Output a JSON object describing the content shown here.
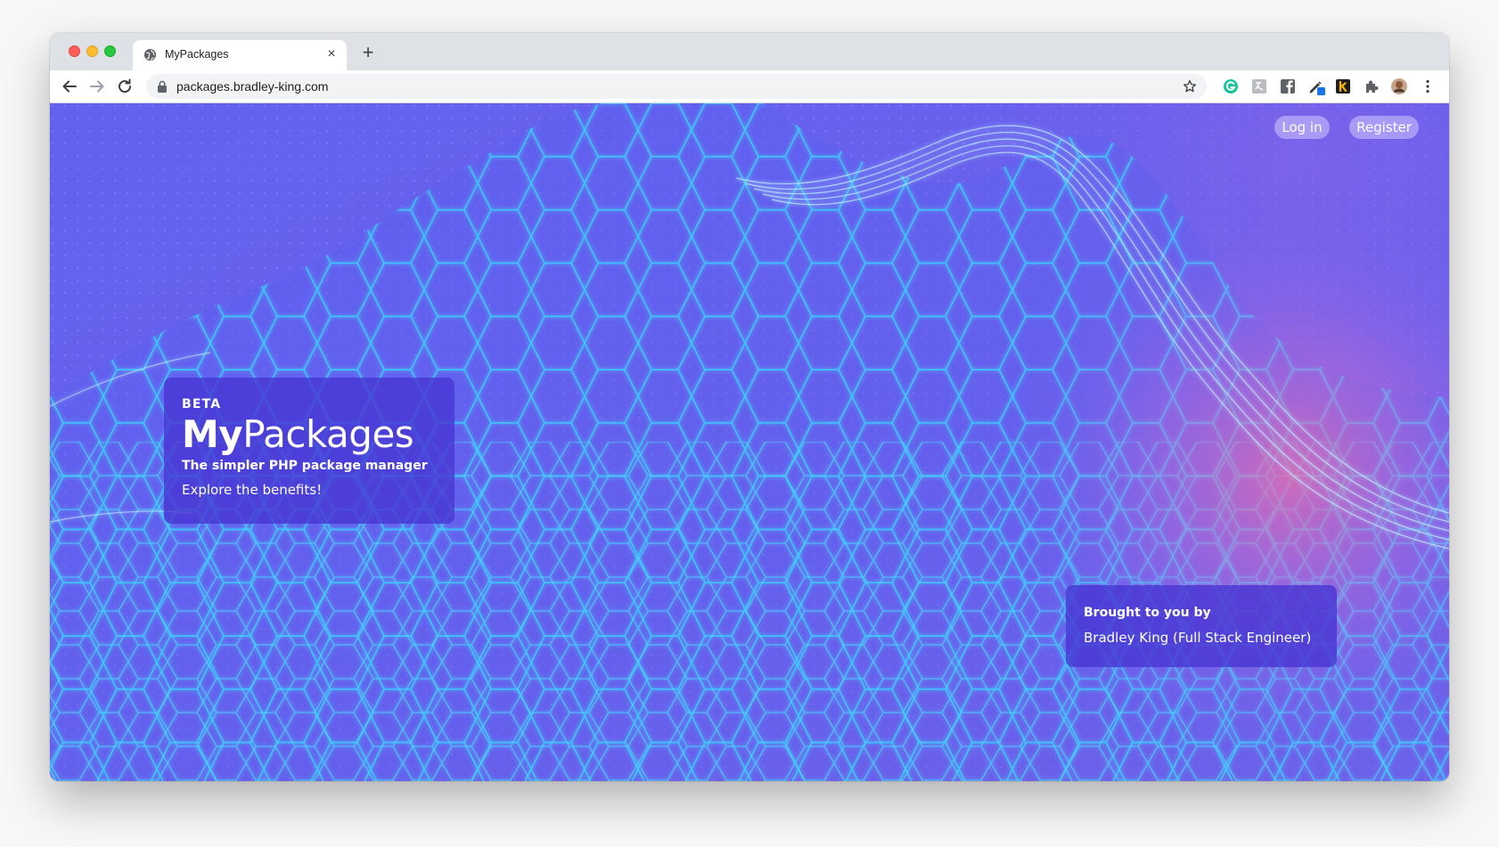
{
  "browser": {
    "tab_title": "MyPackages",
    "tab_close_glyph": "×",
    "new_tab_glyph": "+",
    "url": "packages.bradley-king.com",
    "extensions": [
      "grammarly-icon",
      "translate-icon",
      "facebook-icon",
      "pen-icon",
      "keeper-icon",
      "puzzle-icon",
      "profile-avatar",
      "menu-icon"
    ]
  },
  "header": {
    "login_label": "Log in",
    "register_label": "Register"
  },
  "hero": {
    "badge": "BETA",
    "brand_strong": "My",
    "brand_light": "Packages",
    "tagline": "The simpler PHP package manager",
    "cta": "Explore the benefits!"
  },
  "credit": {
    "label": "Brought to you by",
    "name": "Bradley King (Full Stack Engineer)"
  },
  "colors": {
    "page_background": "#6a61ee",
    "mesh_line": "#37c8ff",
    "card_background": "#4634d2",
    "glow_pink": "#f06eaa"
  }
}
